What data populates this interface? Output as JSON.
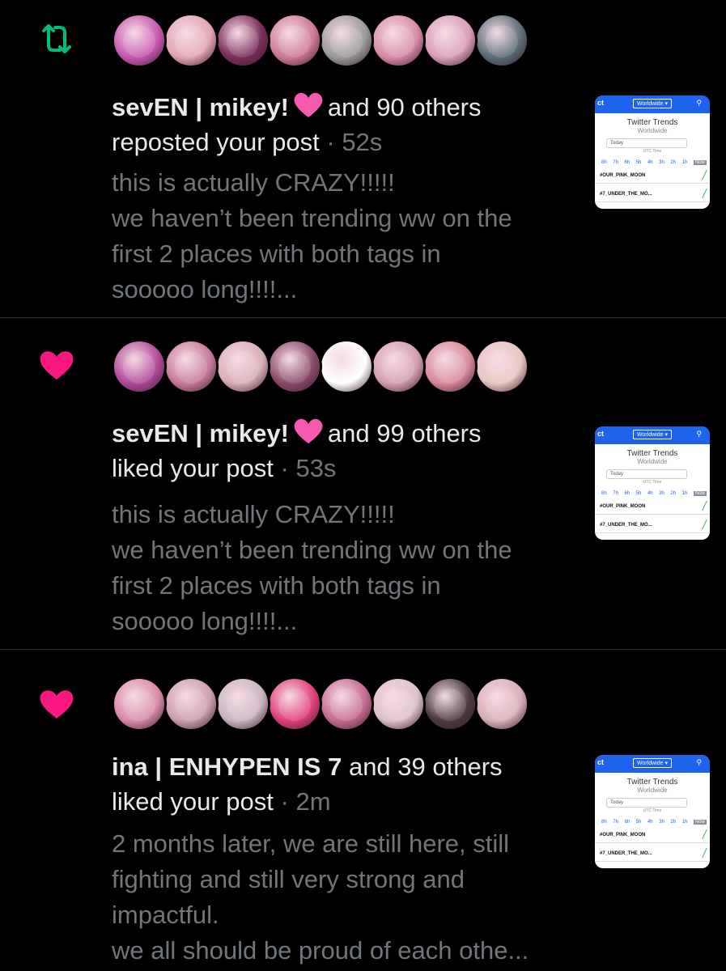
{
  "notifications": [
    {
      "kind": "repost",
      "icon": "repost-icon",
      "icon_color": "#00ba7c",
      "avatar_colors": [
        "#c85ab0",
        "#e3a7b4",
        "#7a2d5a",
        "#ce7a93",
        "#9a9a9a",
        "#d98ba8",
        "#d9a0b8",
        "#5b6e78"
      ],
      "name": "sevEN | mikey!",
      "others": "and 90 others",
      "action": "reposted your post",
      "time": "· 52s",
      "body": "this is actually CRAZY!!!!!\nwe haven’t been trending ww on the\nfirst 2 places with both tags in\nsooooo long!!!!..."
    },
    {
      "kind": "like",
      "icon": "heart-icon",
      "icon_color": "#f91880",
      "avatar_colors": [
        "#b04a9a",
        "#c77a9a",
        "#d9b0b8",
        "#8a4a6a",
        "#ffffff",
        "#d4a0b0",
        "#d98a9a",
        "#e8c8c0"
      ],
      "name": "sevEN | mikey!",
      "others": "and 99 others",
      "action": "liked your post",
      "time": "· 53s",
      "body": "this is actually CRAZY!!!!!\nwe haven’t been trending ww on the\nfirst 2 places with both tags in\nsooooo long!!!!..."
    },
    {
      "kind": "like",
      "icon": "heart-icon",
      "icon_color": "#f91880",
      "avatar_colors": [
        "#d98aa8",
        "#caa0ac",
        "#c9b6c0",
        "#e0407a",
        "#c56c92",
        "#dcc2cc",
        "#4a3a40",
        "#d8b0b8"
      ],
      "name": "ina | ENHYPEN IS 7",
      "others": "and 39 others",
      "action": "liked your post",
      "time": "· 2m",
      "body": "2 months later, we are still here, still\nfighting and still very strong and\nimpactful.\nwe all should be proud of each othe..."
    }
  ],
  "name_emoji": "pink-heart-emoji",
  "thumbnail": {
    "fragment": "ct",
    "selector": "Worldwide ▾",
    "title": "Twitter Trends",
    "subtitle": "Worldwide",
    "date": "Today",
    "utc": "UTC Time",
    "hours": [
      "8h",
      "7h",
      "6h",
      "5h",
      "4h",
      "3h",
      "2h",
      "1h",
      "Now"
    ],
    "rows": [
      "#OUR_PINK_MOON",
      "#7_UNDER_THE_MO..."
    ],
    "accent": "#1d63ed"
  }
}
